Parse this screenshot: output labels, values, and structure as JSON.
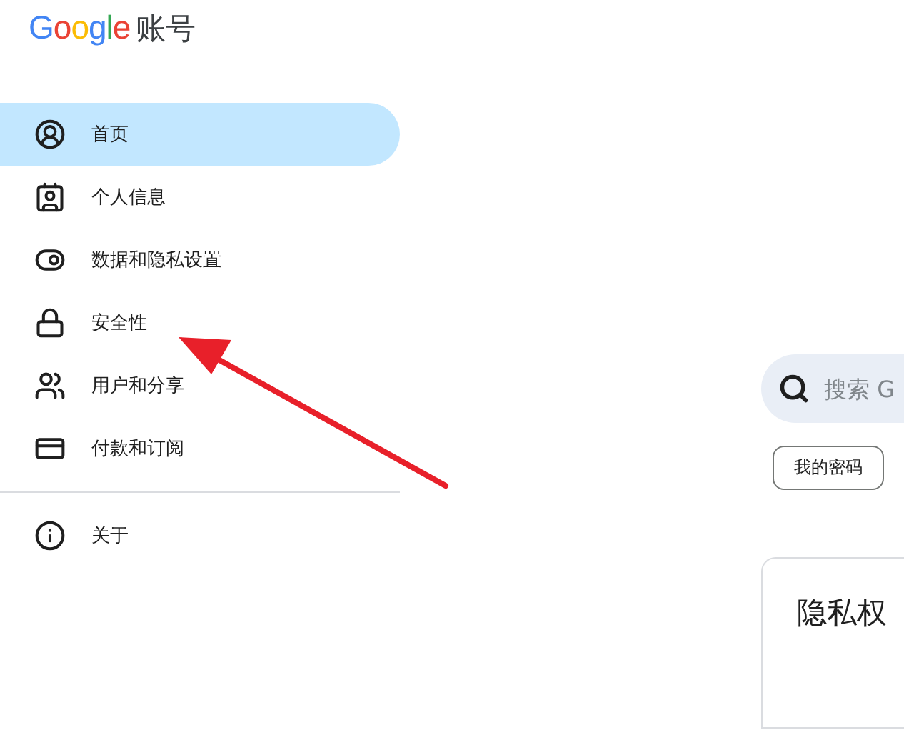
{
  "header": {
    "logo": "Google",
    "title": "账号"
  },
  "sidebar": {
    "items": [
      {
        "kind": "home",
        "label": "首页",
        "selected": true
      },
      {
        "kind": "personal",
        "label": "个人信息",
        "selected": false
      },
      {
        "kind": "privacy",
        "label": "数据和隐私设置",
        "selected": false
      },
      {
        "kind": "security",
        "label": "安全性",
        "selected": false
      },
      {
        "kind": "people",
        "label": "用户和分享",
        "selected": false
      },
      {
        "kind": "payments",
        "label": "付款和订阅",
        "selected": false
      }
    ],
    "footer_items": [
      {
        "kind": "about",
        "label": "关于",
        "selected": false
      }
    ]
  },
  "main": {
    "search": {
      "placeholder": "搜索 G"
    },
    "chips": [
      "我的密码"
    ],
    "card": {
      "title": "隐私权"
    }
  }
}
